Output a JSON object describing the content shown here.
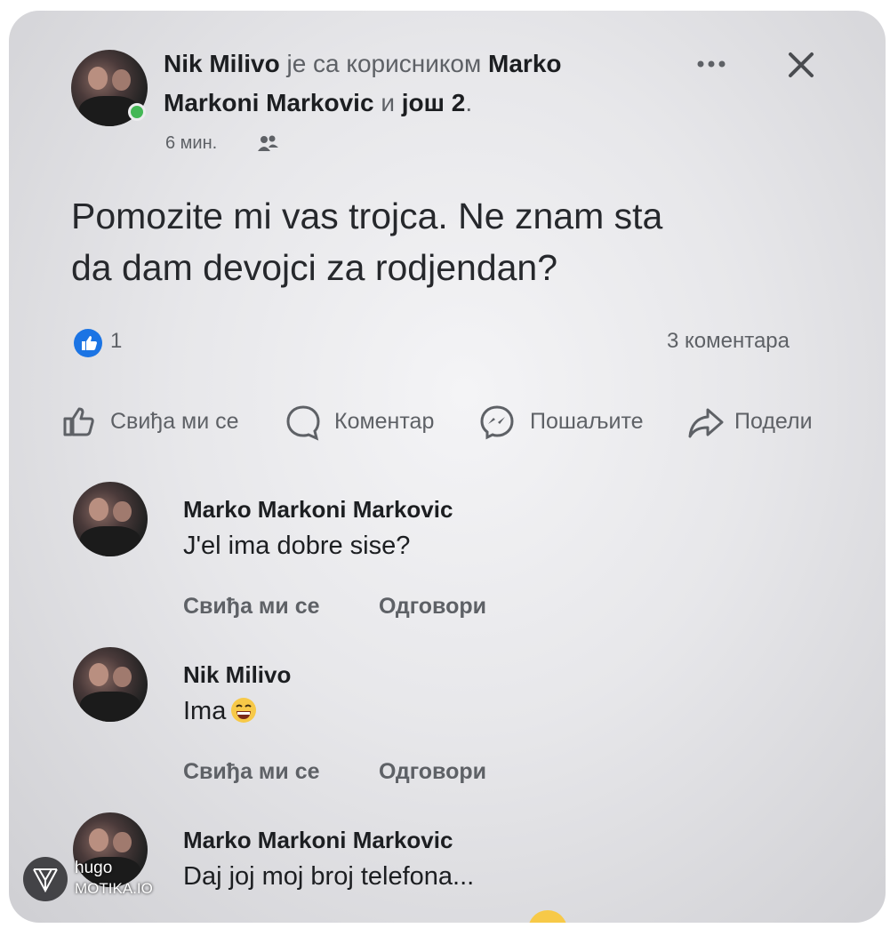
{
  "post": {
    "author": "Nik Milivo",
    "with_text": "је са корисником",
    "tagged_1": "Marko",
    "tagged_2": "Markoni Markovic",
    "and_text": "и",
    "others": "још 2",
    "period": ".",
    "time": "6 мин.",
    "body_line1": "Pomozite mi vas trojca. Ne znam sta",
    "body_line2": "da dam devojci za rodjendan?",
    "like_count": "1",
    "comment_count": "3 коментара",
    "actions": {
      "like": "Свиђа ми се",
      "comment": "Коментар",
      "send": "Пошаљите",
      "share": "Подели"
    }
  },
  "comments": [
    {
      "author": "Marko Markoni Markovic",
      "text": "J'el ima dobre sise?",
      "like": "Свиђа ми се",
      "reply": "Одговори"
    },
    {
      "author": "Nik Milivo",
      "text": "Ima",
      "like": "Свиђа ми се",
      "reply": "Одговори"
    },
    {
      "author": "Marko Markoni Markovic",
      "text": "Daj joj moj broj telefona..."
    }
  ],
  "watermark": {
    "line1": "hugo",
    "line2": "MOTIKA.IO"
  },
  "colors": {
    "like_blue": "#1b74e4",
    "online_green": "#44b755",
    "text_dark": "#1c1e21",
    "text_gray": "#5e6166",
    "emoji_yellow": "#f7c948"
  }
}
